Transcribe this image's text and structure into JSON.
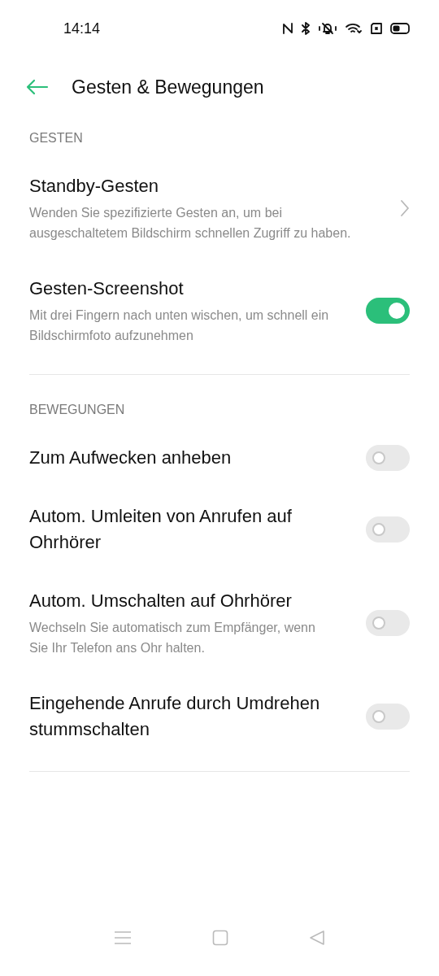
{
  "status_bar": {
    "time": "14:14"
  },
  "header": {
    "title": "Gesten & Bewegungen"
  },
  "sections": [
    {
      "title": "GESTEN",
      "items": [
        {
          "kind": "link",
          "title": "Standby-Gesten",
          "description": "Wenden Sie spezifizierte Gesten an, um bei ausgeschaltetem Bildschirm schnellen Zugriff zu haben."
        },
        {
          "kind": "switch",
          "title": "Gesten-Screenshot",
          "description": "Mit drei Fingern nach unten wischen, um schnell ein Bildschirmfoto aufzunehmen",
          "on": true
        }
      ]
    },
    {
      "title": "BEWEGUNGEN",
      "items": [
        {
          "kind": "switch",
          "title": "Zum Aufwecken anheben",
          "on": false
        },
        {
          "kind": "switch",
          "title": "Autom. Umleiten von Anrufen auf Ohrhörer",
          "on": false
        },
        {
          "kind": "switch",
          "title": "Autom. Umschalten auf Ohrhörer",
          "description": "Wechseln Sie automatisch zum Empfänger, wenn Sie Ihr Telefon ans Ohr halten.",
          "on": false
        },
        {
          "kind": "switch",
          "title": "Eingehende Anrufe durch Umdrehen stummschalten",
          "on": false
        }
      ]
    }
  ]
}
